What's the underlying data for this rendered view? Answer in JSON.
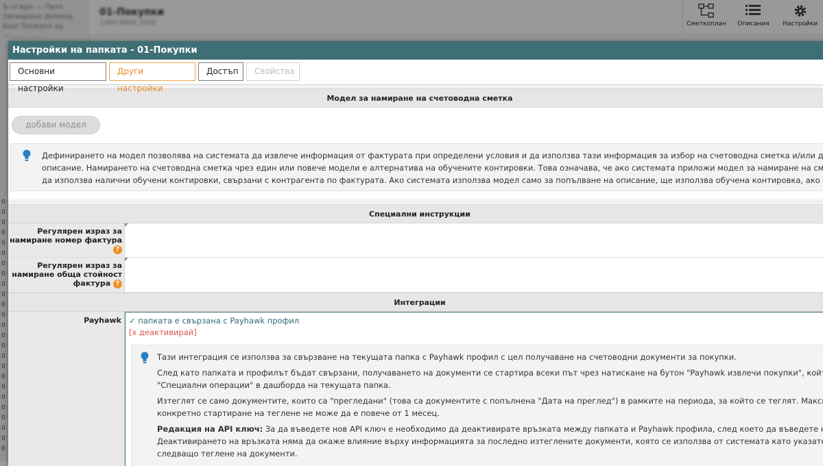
{
  "background": {
    "left_lines": [
      "Ъ нгжрн — Пвлл",
      "Запиарани Деменд",
      "Бщо Трежекл ад",
      "— ……  ……",
      "..."
    ],
    "left_marks": [
      "0",
      "0",
      "0",
      "0",
      "0",
      "0",
      "0",
      "0",
      "0",
      "0",
      "0",
      "0",
      "0",
      "0",
      "0",
      "0",
      "0",
      "0",
      "0",
      "0",
      "0",
      "0",
      "0",
      "0",
      "0"
    ],
    "title": "01-Покупки",
    "subtitle": "1400 8800 2020",
    "toolbar": [
      {
        "icon": "chart-of-accounts-icon",
        "label": "Сметкоплан"
      },
      {
        "icon": "list-icon",
        "label": "Описания"
      },
      {
        "icon": "gear-icon",
        "label": "Настройки"
      }
    ]
  },
  "modal": {
    "title": "Настройки на папката - 01-Покупки",
    "tabs": {
      "basic": "Основни настройки",
      "other": "Други настройки",
      "access": "Достъп",
      "properties": "Свойства"
    },
    "model_section": {
      "header": "Модел за намиране на счетоводна сметка",
      "add_button": "добави модел",
      "info_lines": [
        "Дефинирането на модел позволява на системата да извлече информация от фактурата при определени условия и да използва тази информация за избор на счетоводна сметка и/или доб",
        "описание. Намирането на счетоводна сметка чрез един или повече модели е алтернатива на обучените контировки. Това означава, че ако системата приложи модел за намиране на смет",
        "да използва налични обучени контировки, свързани с контрагента по фактурата. Ако системата използва модел само за попълване на описание, ще използва обучена контировка, ако та"
      ]
    },
    "special_section": {
      "header": "Специални инструкции",
      "invoice_number_label_1": "Регулярен израз за",
      "invoice_number_label_2": "намиране номер фактура",
      "total_label_1": "Регулярен израз за",
      "total_label_2": "намиране обща стойност",
      "total_label_3": "фактура",
      "help_glyph": "?"
    },
    "integrations_section": {
      "header": "Интеграции",
      "payhawk_label": "Payhawk",
      "linked_text": "✓ папката е свързана с Payhawk профил",
      "deactivate_text": "[x деактивирай]",
      "info": {
        "p1": "Тази интеграция се използва за свързване на текущата папка с Payhawk профил с цел получаване на счетоводни документи за покупки.",
        "p2_l1": "След като папката и профилът бъдат свързани, получаването на документи се стартира всеки път чрез натискане на бутон \"Payhawk извлечи покупки\", който",
        "p2_l2": "\"Специални операции\" в дашборда на текущата папка.",
        "p3_l1": "Изтеглят се само документите, които са \"прегледани\" (това са документите с попълнена \"Дата на преглед\") в рамките на периода, за който се теглят. Максима",
        "p3_l2": "конкретно стартиране на теглене не може да е повече от 1 месец.",
        "p4_bold": "Редакция на API ключ:",
        "p4_l1": " За да въведете нов API ключ е необходимо да деактивирате връзката между папката и Payhawk профила, след което да въведете но",
        "p4_l2": "Деактивирането на връзката няма да окаже влияние върху информацията за последно изтеглените документи, която се използва от системата като указател с",
        "p4_l3": "следващо теглене на документи."
      }
    }
  },
  "colors": {
    "title_bar": "#3e6f74",
    "active_tab": "#e8892b",
    "help_badge": "#f0912a",
    "info_icon": "#2a7fc1",
    "deactivate": "#d9534f",
    "linked": "#2f6b70"
  }
}
